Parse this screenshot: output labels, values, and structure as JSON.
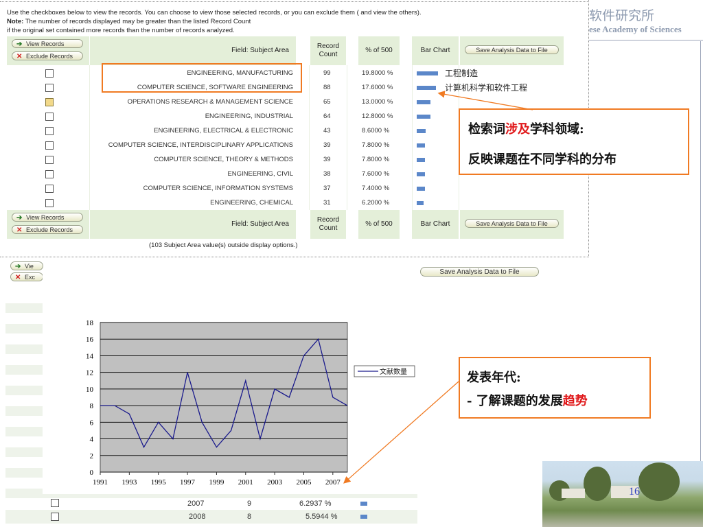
{
  "header": {
    "org_cn": "软件研究所",
    "org_en": "ese Academy of Sciences"
  },
  "intro": {
    "line1": "Use the checkboxes below to view the records. You can choose to view those selected records, or you can exclude them ( and view the others).",
    "line2_bold": "Note:",
    "line2": " The number of records displayed may be greater than the listed Record Count",
    "line3": "if the original set contained more records than the number of records analyzed."
  },
  "table": {
    "view_records": "View Records",
    "exclude_records": "Exclude Records",
    "field_header": "Field: Subject Area",
    "record_count_header": "Record Count",
    "pct_header": "% of 500",
    "bar_chart_header": "Bar Chart",
    "save_button": "Save Analysis Data to File",
    "rows": [
      {
        "label": "ENGINEERING, MANUFACTURING",
        "count": "99",
        "pct": "19.8000 %",
        "bar": 0.198,
        "zh": "工程制造"
      },
      {
        "label": "COMPUTER SCIENCE, SOFTWARE ENGINEERING",
        "count": "88",
        "pct": "17.6000 %",
        "bar": 0.176,
        "zh": "计算机科学和软件工程"
      },
      {
        "label": "OPERATIONS RESEARCH & MANAGEMENT SCIENCE",
        "count": "65",
        "pct": "13.0000 %",
        "bar": 0.13,
        "zh": ""
      },
      {
        "label": "ENGINEERING, INDUSTRIAL",
        "count": "64",
        "pct": "12.8000 %",
        "bar": 0.128,
        "zh": ""
      },
      {
        "label": "ENGINEERING, ELECTRICAL & ELECTRONIC",
        "count": "43",
        "pct": "8.6000 %",
        "bar": 0.086,
        "zh": ""
      },
      {
        "label": "COMPUTER SCIENCE, INTERDISCIPLINARY APPLICATIONS",
        "count": "39",
        "pct": "7.8000 %",
        "bar": 0.078,
        "zh": ""
      },
      {
        "label": "COMPUTER SCIENCE, THEORY & METHODS",
        "count": "39",
        "pct": "7.8000 %",
        "bar": 0.078,
        "zh": ""
      },
      {
        "label": "ENGINEERING, CIVIL",
        "count": "38",
        "pct": "7.6000 %",
        "bar": 0.076,
        "zh": ""
      },
      {
        "label": "COMPUTER SCIENCE, INFORMATION SYSTEMS",
        "count": "37",
        "pct": "7.4000 %",
        "bar": 0.074,
        "zh": ""
      },
      {
        "label": "ENGINEERING, CHEMICAL",
        "count": "31",
        "pct": "6.2000 %",
        "bar": 0.062,
        "zh": ""
      }
    ],
    "outside_note": "(103 Subject Area value(s) outside display options.)"
  },
  "second_panel": {
    "view_partial": "Vie",
    "exclude_partial": "Exc",
    "save_button": "Save Analysis Data to File",
    "rows": [
      {
        "year": "2007",
        "count": "9",
        "pct": "6.2937 %"
      },
      {
        "year": "2008",
        "count": "8",
        "pct": "5.5944 %"
      }
    ]
  },
  "callout1": {
    "line1_a": "检索词",
    "line1_red": "涉及",
    "line1_b": "学科领域:",
    "line2": "反映课题在不同学科的分布"
  },
  "callout2": {
    "line1": "发表年代:",
    "line2_a": "- 了解课题的发展",
    "line2_red": "趋势"
  },
  "page_number": "16",
  "colors": {
    "orange": "#f07a22",
    "red": "#e0181a",
    "bar_blue": "#5b87c9",
    "header_green": "#e4efd9",
    "plot_bg": "#c0c0c0",
    "line": "#1a1a8c"
  },
  "chart_data": {
    "type": "line",
    "x": [
      1991,
      1992,
      1993,
      1994,
      1995,
      1996,
      1997,
      1998,
      1999,
      2000,
      2001,
      2002,
      2003,
      2004,
      2005,
      2006,
      2007,
      2008
    ],
    "x_tick_labels": [
      "1991",
      "1993",
      "1995",
      "1997",
      "1999",
      "2001",
      "2003",
      "2005",
      "2007"
    ],
    "series": [
      {
        "name": "文献数量",
        "values": [
          8,
          8,
          7,
          3,
          6,
          4,
          12,
          6,
          3,
          5,
          11,
          4,
          10,
          9,
          14,
          16,
          9,
          8
        ]
      }
    ],
    "ylim": [
      0,
      18
    ],
    "y_ticks": [
      0,
      2,
      4,
      6,
      8,
      10,
      12,
      14,
      16,
      18
    ],
    "grid": true,
    "legend": "right"
  }
}
